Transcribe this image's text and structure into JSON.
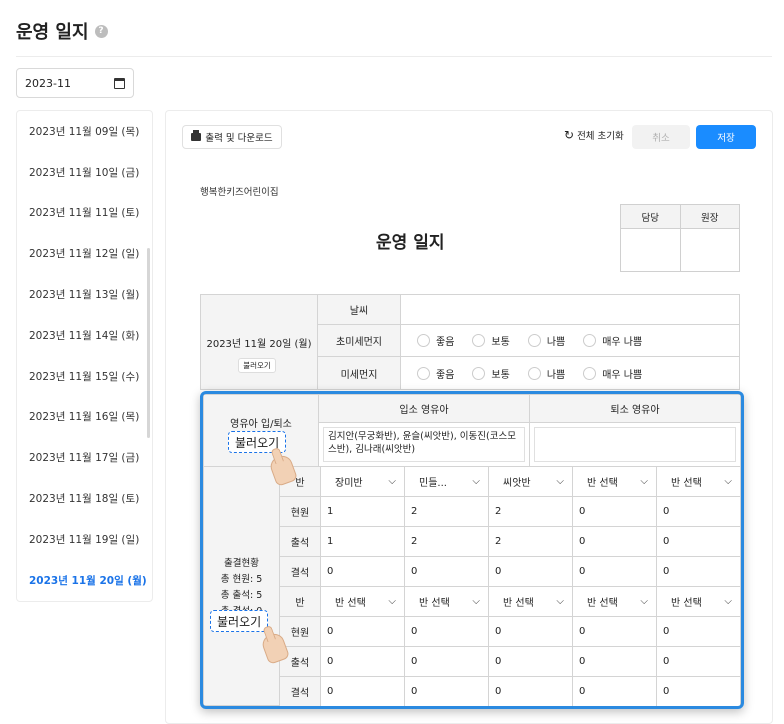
{
  "page": {
    "title": "운영 일지",
    "help_icon": "?"
  },
  "date_picker": {
    "value": "2023-11"
  },
  "date_list": [
    {
      "label": "2023년 11월 09일 (목)",
      "active": false
    },
    {
      "label": "2023년 11월 10일 (금)",
      "active": false
    },
    {
      "label": "2023년 11월 11일 (토)",
      "active": false
    },
    {
      "label": "2023년 11월 12일 (일)",
      "active": false
    },
    {
      "label": "2023년 11월 13일 (월)",
      "active": false
    },
    {
      "label": "2023년 11월 14일 (화)",
      "active": false
    },
    {
      "label": "2023년 11월 15일 (수)",
      "active": false
    },
    {
      "label": "2023년 11월 16일 (목)",
      "active": false
    },
    {
      "label": "2023년 11월 17일 (금)",
      "active": false
    },
    {
      "label": "2023년 11월 18일 (토)",
      "active": false
    },
    {
      "label": "2023년 11월 19일 (일)",
      "active": false
    },
    {
      "label": "2023년 11월 20일 (월)",
      "active": true
    }
  ],
  "toolbar": {
    "print_label": "출력 및 다운로드",
    "reset_label": "전체 초기화",
    "cancel_label": "취소",
    "save_label": "저장"
  },
  "doc": {
    "org_name": "행복한키즈어린이집",
    "title": "운영 일지",
    "sign_headers": [
      "담당",
      "원장"
    ],
    "date_label": "2023년 11월 20일 (월)",
    "load_label_small": "불러오기",
    "weather_label": "날씨",
    "ultrafine_label": "초미세먼지",
    "fine_label": "미세먼지",
    "air_options": [
      "좋음",
      "보통",
      "나쁨",
      "매우 나쁨"
    ],
    "entry_section_label": "영유아 입/퇴소",
    "entry_label": "입소 영유아",
    "exit_label": "퇴소 영유아",
    "entry_value": "김지안(무궁화반), 윤슬(씨앗반), 이동진(코스모스반), 김나래(씨앗반)",
    "exit_value": "",
    "attendance_title": "출결현황",
    "attendance_total_enrolled": "총 현원: 5",
    "attendance_total_present": "총 출석: 5",
    "attendance_total_absent": "총 결석: 0",
    "row_labels": {
      "class": "반",
      "enrolled": "현원",
      "present": "출석",
      "absent": "결석"
    },
    "block1": {
      "classes": [
        "장미반",
        "민들...",
        "씨앗반",
        "반 선택",
        "반 선택"
      ],
      "enrolled": [
        "1",
        "2",
        "2",
        "0",
        "0"
      ],
      "present": [
        "1",
        "2",
        "2",
        "0",
        "0"
      ],
      "absent": [
        "0",
        "0",
        "0",
        "0",
        "0"
      ]
    },
    "block2": {
      "classes": [
        "반 선택",
        "반 선택",
        "반 선택",
        "반 선택",
        "반 선택"
      ],
      "enrolled": [
        "0",
        "0",
        "0",
        "0",
        "0"
      ],
      "present": [
        "0",
        "0",
        "0",
        "0",
        "0"
      ],
      "absent": [
        "0",
        "0",
        "0",
        "0",
        "0"
      ]
    }
  },
  "callouts": {
    "load_label": "불러오기"
  },
  "colors": {
    "accent": "#1a8cff",
    "highlight_border": "#2b8ae0",
    "active_date": "#1a73e8"
  }
}
